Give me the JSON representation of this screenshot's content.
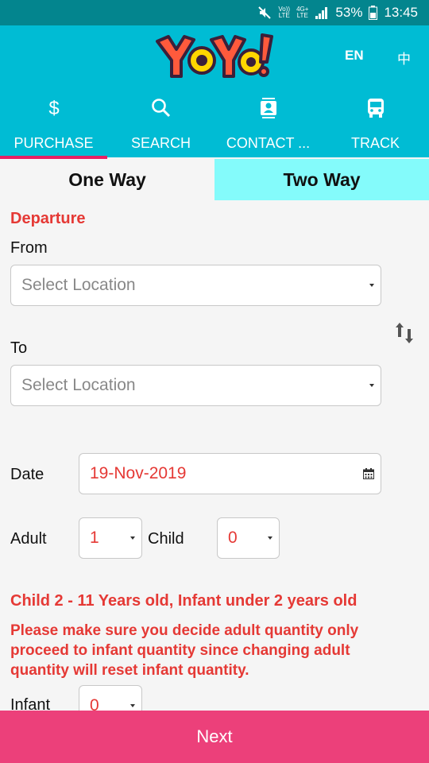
{
  "status": {
    "battery": "53%",
    "time": "13:45",
    "volte_top": "Vo))",
    "volte_bottom": "LTE",
    "net_top": "4G+",
    "net_bottom": "LTE"
  },
  "app": {
    "logo_alt": "YOYO!",
    "lang_en": "EN",
    "lang_zh": "中"
  },
  "nav": {
    "tabs": [
      {
        "label": "PURCHASE",
        "icon": "dollar-icon"
      },
      {
        "label": "SEARCH",
        "icon": "search-icon"
      },
      {
        "label": "CONTACT ...",
        "icon": "contact-icon"
      },
      {
        "label": "TRACK",
        "icon": "bus-icon"
      }
    ],
    "active": "PURCHASE"
  },
  "trip_tabs": {
    "one_way": "One Way",
    "two_way": "Two Way",
    "active": "Two Way"
  },
  "form": {
    "section_title": "Departure",
    "from_label": "From",
    "from_value": "Select Location",
    "to_label": "To",
    "to_value": "Select Location",
    "date_label": "Date",
    "date_value": "19-Nov-2019",
    "adult_label": "Adult",
    "adult_value": "1",
    "child_label": "Child",
    "child_value": "0",
    "infant_label": "Infant",
    "infant_value": "0"
  },
  "notes": {
    "age_note": "Child 2 - 11 Years old, Infant under 2 years old",
    "warning": "Please make sure you decide adult quantity only proceed to infant quantity since changing adult quantity will reset infant quantity."
  },
  "footer": {
    "next_label": "Next"
  },
  "colors": {
    "status": "#03858e",
    "appbar": "#00bcd4",
    "accent": "#e91e63",
    "two_way_bg": "#84fbfb",
    "error": "#e53935",
    "next_bg": "#ec407a"
  }
}
